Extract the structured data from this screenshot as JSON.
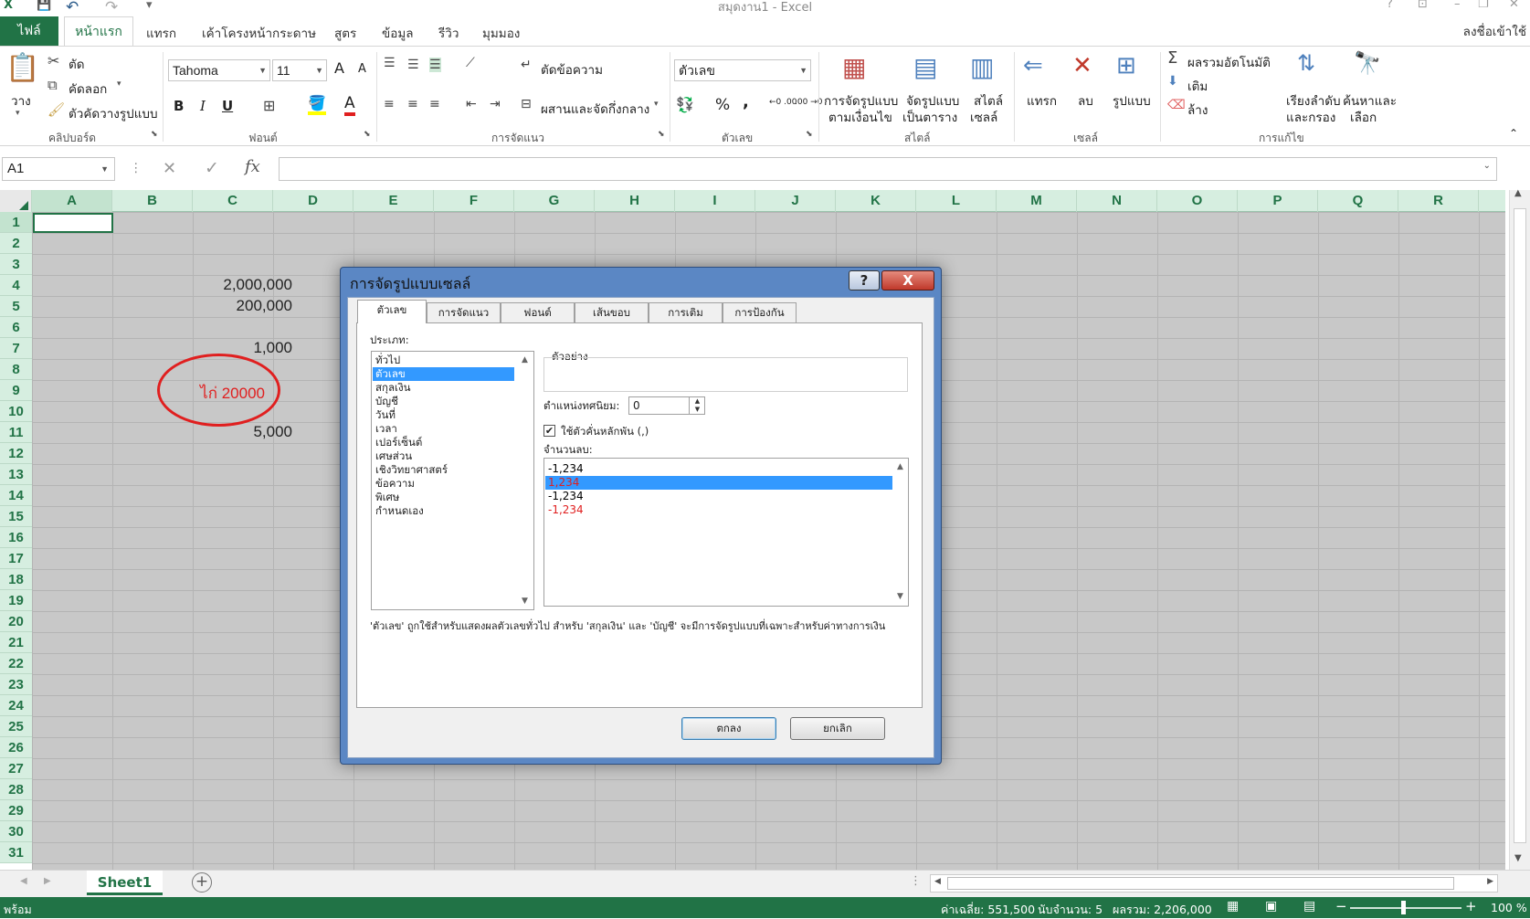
{
  "window": {
    "title": "สมุดงาน1 - Excel"
  },
  "qat": {
    "app": "X",
    "save": "💾",
    "undo": "↶",
    "redo": "↷",
    "custom": "▾"
  },
  "win_controls": {
    "help": "?",
    "ribbon_display": "⊡",
    "minimize": "–",
    "restore": "❐",
    "close": "✕"
  },
  "tabs": {
    "file": "ไฟล์",
    "home": "หน้าแรก",
    "insert": "แทรก",
    "layout": "เค้าโครงหน้ากระดาษ",
    "formulas": "สูตร",
    "data": "ข้อมูล",
    "review": "รีวิว",
    "view": "มุมมอง",
    "signin": "ลงชื่อเข้าใช้"
  },
  "ribbon": {
    "clipboard": {
      "paste": "วาง",
      "cut": "ตัด",
      "copy": "คัดลอก",
      "format_painter": "ตัวคัดวางรูปแบบ",
      "label": "คลิปบอร์ด"
    },
    "font": {
      "name": "Tahoma",
      "size": "11",
      "grow": "A",
      "shrink": "A",
      "bold": "B",
      "italic": "I",
      "underline": "U",
      "font_color": "A",
      "label": "ฟอนต์"
    },
    "alignment": {
      "wrap": "ตัดข้อความ",
      "merge": "ผสานและจัดกึ่งกลาง",
      "label": "การจัดแนว"
    },
    "number": {
      "format": "ตัวเลข",
      "percent": "%",
      "comma": ",",
      "inc_decimal": "←0 .00",
      "dec_decimal": ".00 →0",
      "label": "ตัวเลข"
    },
    "styles": {
      "conditional_1": "การจัดรูปแบบ",
      "conditional_2": "ตามเงื่อนไข",
      "table_1": "จัดรูปแบบ",
      "table_2": "เป็นตาราง",
      "cell_1": "สไตล์",
      "cell_2": "เซลล์",
      "label": "สไตล์"
    },
    "cells": {
      "insert": "แทรก",
      "delete": "ลบ",
      "format": "รูปแบบ",
      "label": "เซลล์"
    },
    "editing": {
      "autosum": "ผลรวมอัตโนมัติ",
      "fill": "เติม",
      "clear": "ล้าง",
      "sort_1": "เรียงลำดับ",
      "sort_2": "และกรอง",
      "find_1": "ค้นหาและ",
      "find_2": "เลือก",
      "label": "การแก้ไข"
    }
  },
  "formula_bar": {
    "name_box": "A1",
    "cancel": "✕",
    "enter": "✓",
    "fx": "fx",
    "value": ""
  },
  "grid": {
    "columns": [
      "A",
      "B",
      "C",
      "D",
      "E",
      "F",
      "G",
      "H",
      "I",
      "J",
      "K",
      "L",
      "M",
      "N",
      "O",
      "P",
      "Q",
      "R"
    ],
    "rows": [
      "1",
      "2",
      "3",
      "4",
      "5",
      "6",
      "7",
      "8",
      "9",
      "10",
      "11",
      "12",
      "13",
      "14",
      "15",
      "16",
      "17",
      "18",
      "19",
      "20",
      "21",
      "22",
      "23",
      "24",
      "25",
      "26",
      "27",
      "28",
      "29",
      "30",
      "31"
    ],
    "cells": {
      "c4": "2,000,000",
      "c5": "200,000",
      "c7": "1,000",
      "c9": "ไก่ 20000",
      "c11": "5,000"
    }
  },
  "sheet_tabs": {
    "active": "Sheet1",
    "add": "+"
  },
  "status": {
    "ready": "พร้อม",
    "average": "ค่าเฉลี่ย: 551,500",
    "count": "นับจำนวน: 5",
    "sum": "ผลรวม: 2,206,000",
    "zoom": "100 %"
  },
  "dialog": {
    "title": "การจัดรูปแบบเซลล์",
    "help": "?",
    "close": "X",
    "tabs": [
      "ตัวเลข",
      "การจัดแนว",
      "ฟอนต์",
      "เส้นขอบ",
      "การเติม",
      "การป้องกัน"
    ],
    "category_label": "ประเภท:",
    "categories": [
      "ทั่วไป",
      "ตัวเลข",
      "สกุลเงิน",
      "บัญชี",
      "วันที่",
      "เวลา",
      "เปอร์เซ็นต์",
      "เศษส่วน",
      "เชิงวิทยาศาสตร์",
      "ข้อความ",
      "พิเศษ",
      "กำหนดเอง"
    ],
    "selected_category": 1,
    "sample_label": "ตัวอย่าง",
    "decimal_label": "ตำแหน่งทศนิยม:",
    "decimal_value": "0",
    "separator_label": "ใช้ตัวคั่นหลักพัน (,)",
    "separator_checked": true,
    "negative_label": "จำนวนลบ:",
    "negative_options": [
      {
        "text": "-1,234",
        "color": "#000000"
      },
      {
        "text": "1,234",
        "color": "#e01f1f"
      },
      {
        "text": "-1,234",
        "color": "#000000"
      },
      {
        "text": "-1,234",
        "color": "#e01f1f"
      }
    ],
    "selected_negative": 1,
    "description": "'ตัวเลข' ถูกใช้สำหรับแสดงผลตัวเลขทั่วไป สำหรับ 'สกุลเงิน' และ 'บัญชี' จะมีการจัดรูปแบบที่เฉพาะสำหรับค่าทางการเงิน",
    "ok": "ตกลง",
    "cancel": "ยกเลิก"
  },
  "colors": {
    "excel_green": "#217346",
    "annotation_red": "#e01f1f",
    "selection_blue": "#3399ff"
  }
}
